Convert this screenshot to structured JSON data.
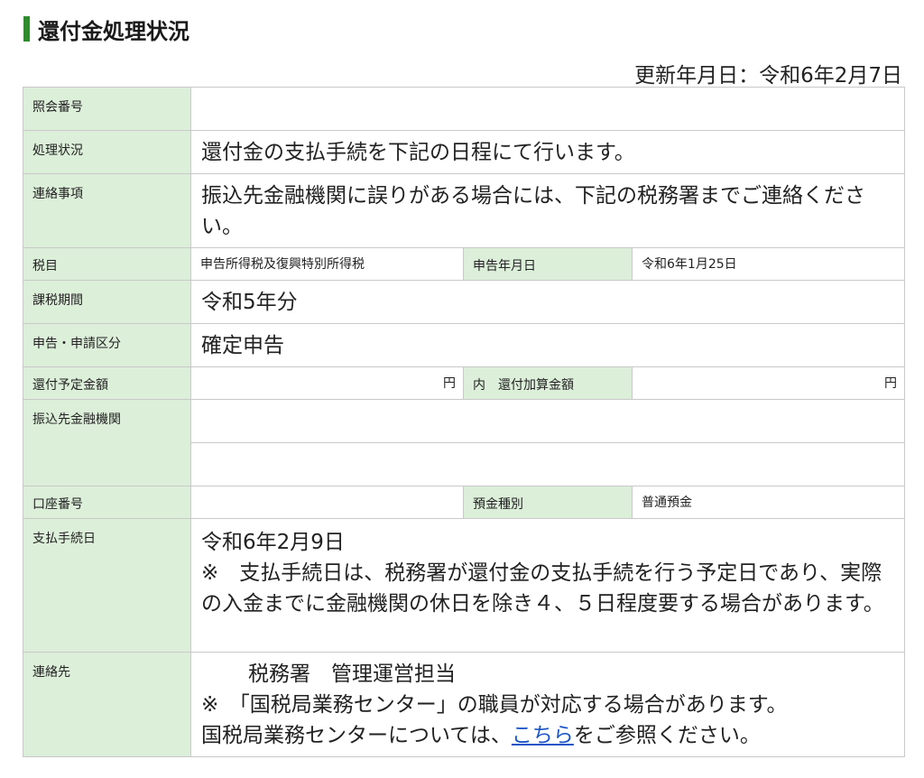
{
  "header": {
    "title": "還付金処理状況",
    "updated": "更新年月日：令和6年2月7日"
  },
  "rows": {
    "reference": {
      "label": "照会番号",
      "value": ""
    },
    "status": {
      "label": "処理状況",
      "value": "還付金の支払手続を下記の日程にて行います。"
    },
    "notice": {
      "label": "連絡事項",
      "value": "振込先金融機関に誤りがある場合には、下記の税務署までご連絡ください。"
    },
    "tax_item": {
      "label": "税目",
      "value": "申告所得税及復興特別所得税",
      "label2": "申告年月日",
      "value2": "令和6年1月25日"
    },
    "period": {
      "label": "課税期間",
      "value": "令和5年分"
    },
    "category": {
      "label": "申告・申請区分",
      "value": "確定申告"
    },
    "amount": {
      "label": "還付予定金額",
      "unit": "円",
      "label2": "内　還付加算金額",
      "unit2": "円"
    },
    "bank": {
      "label": "振込先金融機関",
      "value1": "",
      "value2": ""
    },
    "account": {
      "label": "口座番号",
      "value": "",
      "label2": "預金種別",
      "value2": "普通預金"
    },
    "payment_date": {
      "label": "支払手続日",
      "date": "令和6年2月9日",
      "note": "※　支払手続日は、税務署が還付金の支払手続を行う予定日であり、実際の入金までに金融機関の休日を除き４、５日程度要する場合があります。"
    },
    "contact": {
      "label": "連絡先",
      "office": "税務署　管理運営担当",
      "note": "※　「国税局業務センター」の職員が対応する場合があります。",
      "ref_prefix": "国税局業務センターについては、",
      "ref_link": "こちら",
      "ref_suffix": "をご参照ください。"
    }
  }
}
